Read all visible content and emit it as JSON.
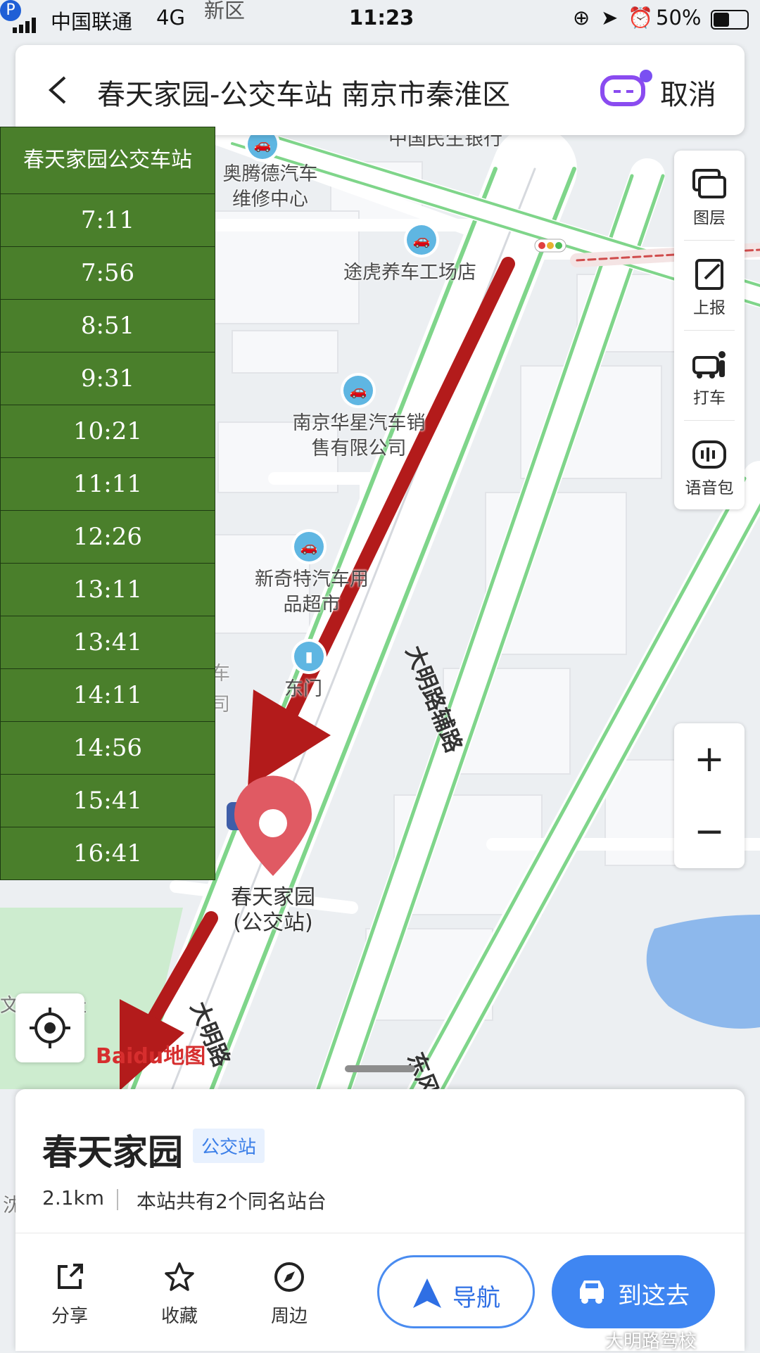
{
  "status_bar": {
    "carrier": "中国联通",
    "network": "4G",
    "time": "11:23",
    "battery": "50%",
    "top_label": "新区"
  },
  "header": {
    "title": "春天家园-公交车站 南京市秦淮区",
    "cancel_label": "取消"
  },
  "timetable": {
    "title": "春天家园公交车站",
    "times": [
      "7:11",
      "7:56",
      "8:51",
      "9:31",
      "10:21",
      "11:11",
      "12:26",
      "13:11",
      "13:41",
      "14:11",
      "14:56",
      "15:41",
      "16:41"
    ]
  },
  "map": {
    "pois": [
      "中国民生银行",
      "奥腾德汽车维修中心",
      "途虎养车工场店",
      "南京华星汽车销售有限公司",
      "新奇特汽车用品超市",
      "东门"
    ],
    "road_labels": [
      "大明路辅路",
      "大明路",
      "东风"
    ],
    "marker_label": "春天家园\n(公交站)",
    "partial_labels": [
      "车",
      "司",
      "文",
      "址",
      "沈"
    ],
    "logo": "Baidu地图"
  },
  "toolbar": {
    "layers": "图层",
    "report": "上报",
    "taxi": "打车",
    "voice": "语音包"
  },
  "zoom": {
    "in": "+",
    "out": "−"
  },
  "sheet": {
    "name": "春天家园",
    "tag": "公交站",
    "distance": "2.1km",
    "description": "本站共有2个同名站台",
    "actions": {
      "share": "分享",
      "favorite": "收藏",
      "nearby": "周边"
    },
    "navigate": "导航",
    "go_here": "到这去"
  },
  "watermark": "大明路驾校",
  "colors": {
    "timetable_bg": "#4a7f2b",
    "arrow": "#b31b1b",
    "accent": "#3f86f2",
    "marker": "#e05a63"
  }
}
